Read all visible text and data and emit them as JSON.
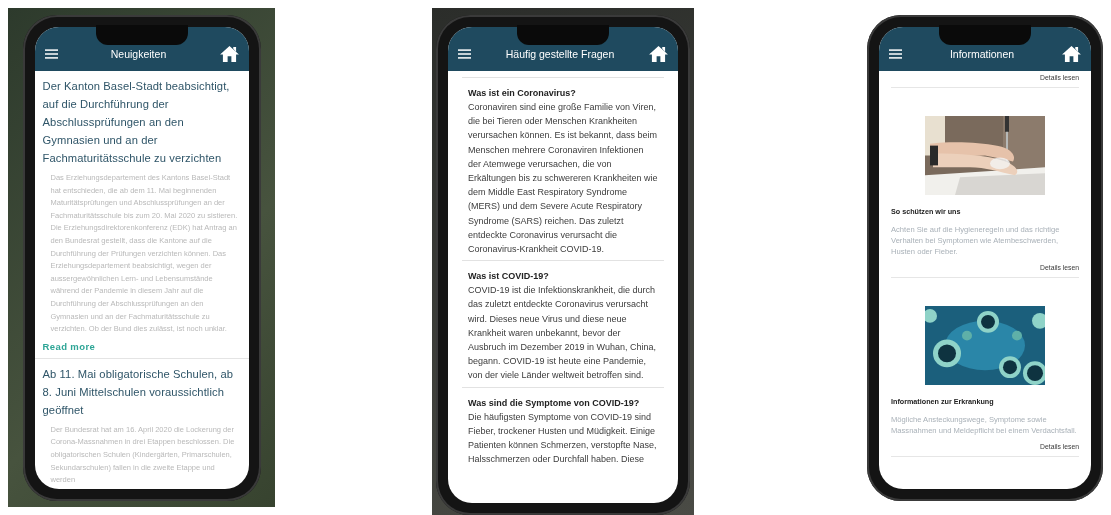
{
  "phones": [
    {
      "kind": "news",
      "title": "Neuigkeiten",
      "articles": [
        {
          "title": "Der Kanton Basel-Stadt beabsichtigt, auf die Durchführung der Abschlussprüfungen an den Gymnasien und an der Fachmaturitätsschule zu verzichten",
          "body": "Das Erziehungsdepartement des Kantons Basel-Stadt hat entschieden, die ab dem 11. Mai beginnenden Maturitätsprüfungen und Abschlussprüfungen an der Fachmaturitätsschule bis zum 20. Mai 2020 zu sistieren. Die Erziehungsdirektorenkonferenz (EDK) hat Antrag an den Bundesrat gestellt, dass die Kantone auf die Durchführung der Prüfungen verzichten können. Das Erziehungsdepartement beabsichtigt, wegen der aussergewöhnlichen Lern- und Lebensumstände während der Pandemie in diesem Jahr auf die Durchführung der Abschlussprüfungen an den Gymnasien und an der Fachmaturitätsschule zu verzichten. Ob der Bund dies zulässt, ist noch unklar.",
          "link": "Read more"
        },
        {
          "title": "Ab 11. Mai obligatorische Schulen, ab 8. Juni Mittelschulen voraussichtlich geöffnet",
          "body": "Der Bundesrat hat am 16. April 2020 die Lockerung der Corona-Massnahmen in drei Etappen beschlossen. Die obligatorischen Schulen (Kindergärten, Primarschulen, Sekundarschulen) fallen in die zweite Etappe und werden"
        }
      ]
    },
    {
      "kind": "faq",
      "title": "Häufig gestellte Fragen",
      "items": [
        {
          "question": "Was ist ein Coronavirus?",
          "answer": "Coronaviren sind eine große Familie von Viren, die bei Tieren oder Menschen Krankheiten verursachen können. Es ist bekannt, dass beim Menschen mehrere Coronaviren Infektionen der Atemwege verursachen, die von Erkältungen bis zu schwereren Krankheiten wie dem Middle East Respiratory Syndrome (MERS) und dem Severe Acute Respiratory Syndrome (SARS) reichen. Das zuletzt entdeckte Coronavirus verursacht die Coronavirus-Krankheit COVID-19."
        },
        {
          "question": "Was ist COVID-19?",
          "answer": "COVID-19 ist die Infektionskrankheit, die durch das zuletzt entdeckte Coronavirus verursacht wird. Dieses neue Virus und diese neue Krankheit waren unbekannt, bevor der Ausbruch im Dezember 2019 in Wuhan, China, begann. COVID-19 ist heute eine Pandemie, von der viele Länder weltweit betroffen sind."
        },
        {
          "question": "Was sind die Symptome von COVID-19?",
          "answer": "Die häufigsten Symptome von COVID-19 sind Fieber, trockener Husten und Müdigkeit. Einige Patienten können Schmerzen, verstopfte Nase, Halsschmerzen oder Durchfall haben. Diese"
        }
      ]
    },
    {
      "kind": "info",
      "title": "Informationen",
      "top_link": "Details lesen",
      "cards": [
        {
          "kind": "picture",
          "title": "So schützen wir uns",
          "body": "Achten Sie auf die Hygieneregeln und das richtige Verhalten bei Symptomen wie Atembeschwerden, Husten oder Fieber.",
          "link": "Details lesen"
        },
        {
          "kind": "picture",
          "title": "Informationen zur Erkrankung",
          "body": "Mögliche Ansteckungswege, Symptome sowie Massnahmen und Meldepflicht bei einem Verdachtsfall.",
          "link": "Details lesen"
        }
      ]
    }
  ]
}
